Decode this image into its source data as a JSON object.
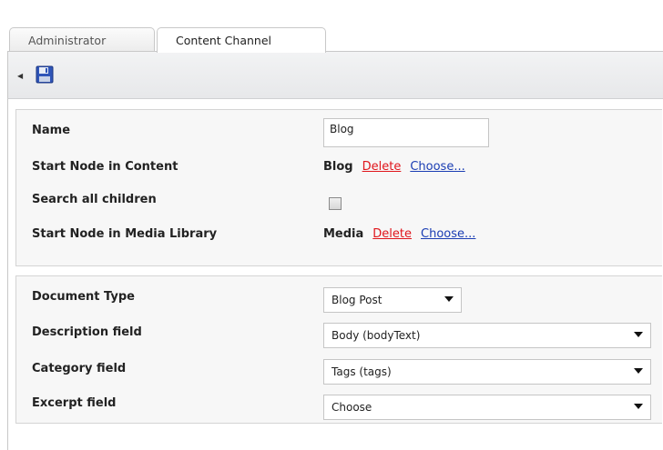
{
  "tabs": [
    {
      "label": "Administrator",
      "active": false
    },
    {
      "label": "Content Channel",
      "active": true
    }
  ],
  "toolbar": {
    "collapse_icon": "triangle-left-icon",
    "save_icon": "floppy-disk-icon"
  },
  "settings": {
    "name_label": "Name",
    "name_value": "Blog",
    "start_node_label": "Start Node in Content",
    "start_node_value": "Blog",
    "start_node_delete": "Delete",
    "start_node_choose": "Choose...",
    "search_children_label": "Search all children",
    "search_children_checked": false,
    "media_node_label": "Start Node in Media Library",
    "media_node_value": "Media",
    "media_node_delete": "Delete",
    "media_node_choose": "Choose..."
  },
  "fields": {
    "doc_type_label": "Document Type",
    "doc_type_value": "Blog Post",
    "description_label": "Description field",
    "description_value": "Body (bodyText)",
    "category_label": "Category field",
    "category_value": "Tags (tags)",
    "excerpt_label": "Excerpt field",
    "excerpt_value": "Choose"
  },
  "colors": {
    "delete_link": "#e0151b",
    "choose_link": "#1a3db3"
  }
}
